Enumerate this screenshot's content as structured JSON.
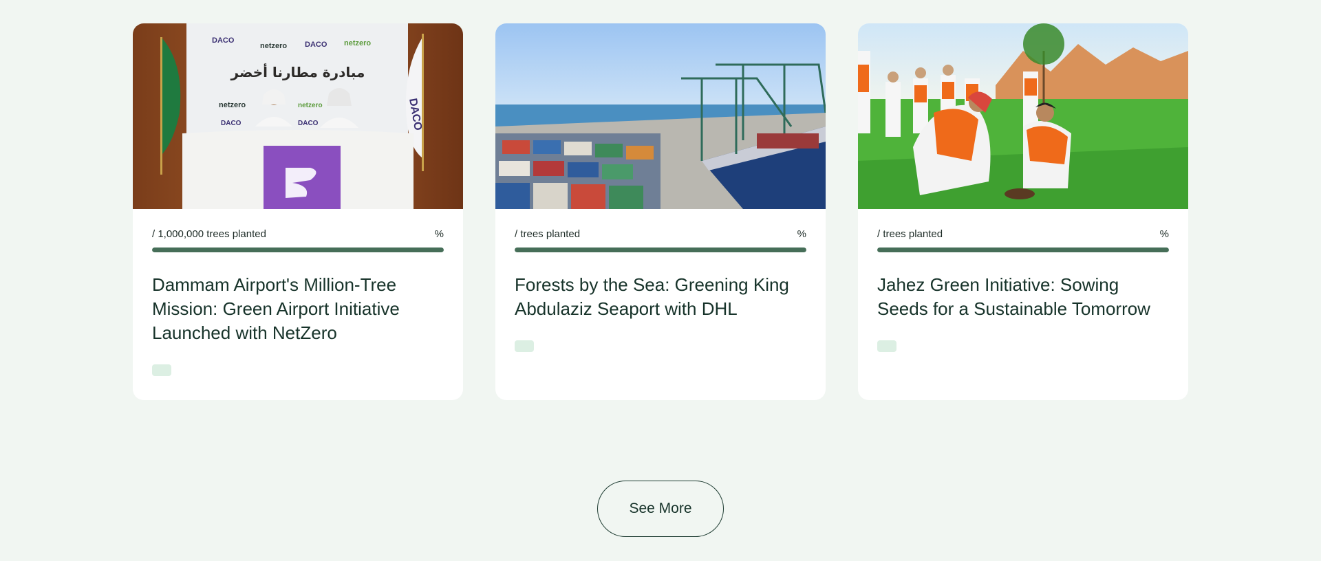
{
  "cards": [
    {
      "image_alt": "signing ceremony",
      "progress_text": "/ 1,000,000 trees planted",
      "percent_label": "%",
      "progress_fraction": 1.0,
      "title": "Dammam Airport's Million-Tree Mission: Green Airport Initiative Launched with NetZero",
      "image_text": {
        "backdrop_arabic": "مبادرة مطارنا أخضر",
        "logo_daco": "DACO",
        "logo_netzero": "netzero"
      }
    },
    {
      "image_alt": "container seaport",
      "progress_text": "/ trees planted",
      "percent_label": "%",
      "progress_fraction": 1.0,
      "title": "Forests by the Sea: Greening King Abdulaziz Seaport with DHL"
    },
    {
      "image_alt": "people planting trees",
      "progress_text": "/ trees planted",
      "percent_label": "%",
      "progress_fraction": 1.0,
      "title": "Jahez Green Initiative: Sowing Seeds for a Sustainable Tomorrow"
    }
  ],
  "see_more_label": "See More",
  "colors": {
    "page_bg": "#f1f6f2",
    "progress_fill": "#466e58",
    "tag_bg": "#dcefe3",
    "text": "#17332a"
  }
}
